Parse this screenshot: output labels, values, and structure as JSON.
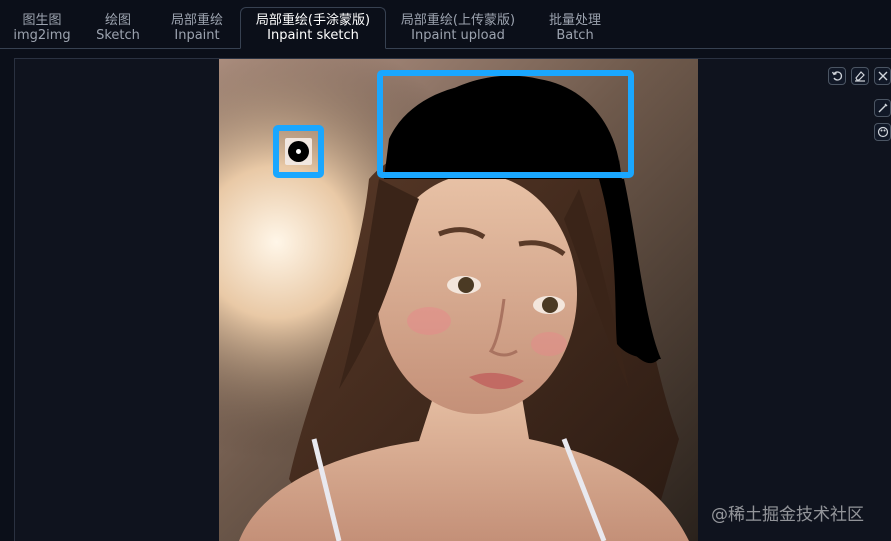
{
  "tabs": [
    {
      "zh": "图生图",
      "en": "img2img",
      "active": false
    },
    {
      "zh": "绘图",
      "en": "Sketch",
      "active": false
    },
    {
      "zh": "局部重绘",
      "en": "Inpaint",
      "active": false
    },
    {
      "zh": "局部重绘(手涂蒙版)",
      "en": "Inpaint sketch",
      "active": true
    },
    {
      "zh": "局部重绘(上传蒙版)",
      "en": "Inpaint upload",
      "active": false
    },
    {
      "zh": "批量处理",
      "en": "Batch",
      "active": false
    }
  ],
  "toolbar": {
    "undo_icon": "undo-icon",
    "eraser_icon": "eraser-icon",
    "close_icon": "close-icon",
    "brush_icon": "brush-icon",
    "palette_icon": "palette-icon"
  },
  "watermark": "@稀土掘金技术社区",
  "colors": {
    "background": "#0b0f19",
    "highlight": "#1aa7ff",
    "mask": "#000000"
  }
}
